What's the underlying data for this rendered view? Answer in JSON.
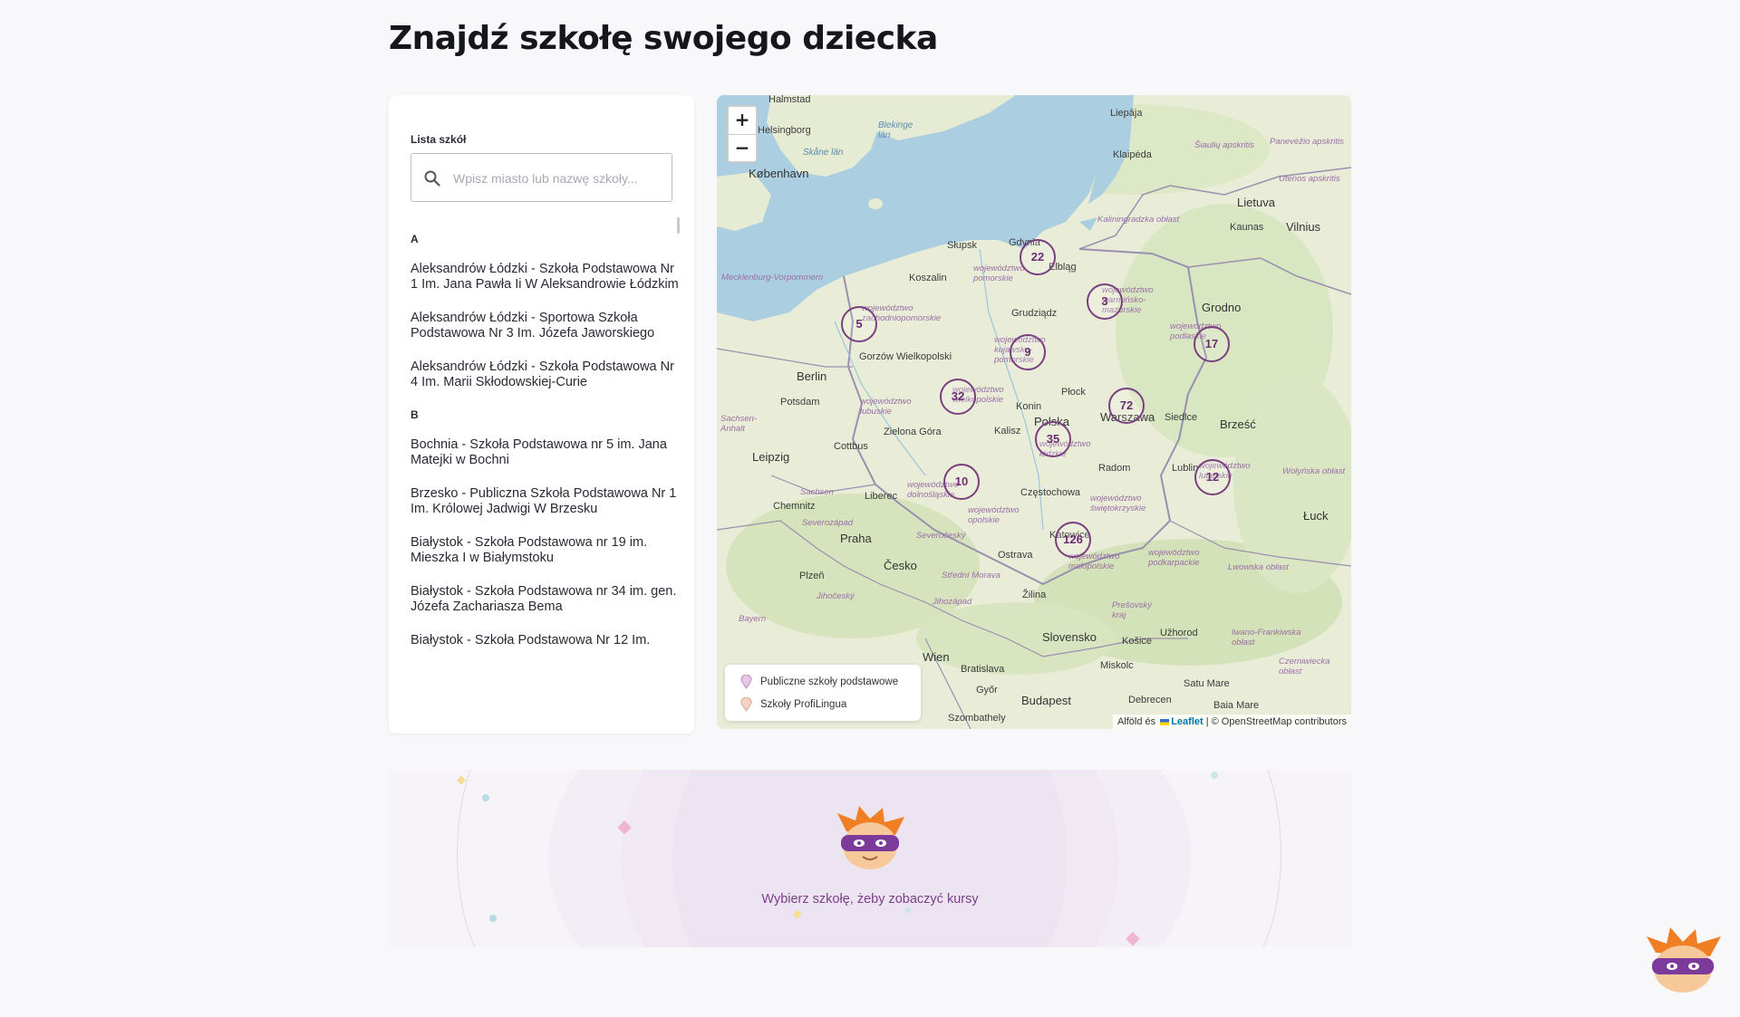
{
  "page": {
    "title": "Znajdź szkołę swojego dziecka"
  },
  "list": {
    "label": "Lista szkół",
    "search_placeholder": "Wpisz miasto lub nazwę szkoły...",
    "groups": [
      {
        "letter": "A",
        "items": [
          "Aleksandrów Łódzki - Szkoła Podstawowa Nr 1 Im. Jana Pawła Ii W Aleksandrowie Łódzkim",
          "Aleksandrów Łódzki - Sportowa Szkoła Podstawowa Nr 3 Im. Józefa Jaworskiego",
          "Aleksandrów Łódzki - Szkoła Podstawowa Nr 4 Im. Marii Skłodowskiej-Curie"
        ]
      },
      {
        "letter": "B",
        "items": [
          "Bochnia - Szkoła Podstawowa nr 5 im. Jana Matejki w Bochni",
          "Brzesko - Publiczna Szkoła Podstawowa Nr 1 Im. Królowej Jadwigi W Brzesku",
          "Białystok - Szkoła Podstawowa nr 19 im. Mieszka I w Białymstoku",
          "Białystok - Szkoła Podstawowa nr 34 im. gen. Józefa Zachariasza Bema",
          "Białystok - Szkoła Podstawowa Nr 12 Im."
        ]
      }
    ]
  },
  "map": {
    "zoom_in": "+",
    "zoom_out": "−",
    "clusters": [
      "22",
      "3",
      "5",
      "9",
      "17",
      "32",
      "72",
      "35",
      "10",
      "12",
      "126"
    ],
    "places": [
      "Halmstad",
      "Helsingborg",
      "København",
      "Liepāja",
      "Klaipėda",
      "Šiaulių apskritis",
      "Panevėžio apskritis",
      "Utenos apskritis",
      "Lietuva",
      "Kaunas",
      "Vilnius",
      "Słupsk",
      "Gdynia",
      "Elbląg",
      "Koszalin",
      "Kaliningradzka obłast",
      "Mecklenburg-Vorpommern",
      "Grudziądz",
      "Grodno",
      "Berlin",
      "Gorzów Wielkopolski",
      "Potsdam",
      "Płock",
      "Konin",
      "Polska",
      "Warszawa",
      "Siedlce",
      "Brześć",
      "Kalisz",
      "Zielona Góra",
      "Cottbus",
      "Leipzig",
      "Liberec",
      "Chemnitz",
      "Częstochowa",
      "Radom",
      "Lublin",
      "Łuck",
      "Praha",
      "Česko",
      "Ostrava",
      "Katowice",
      "Plzeň",
      "Žilina",
      "Slovensko",
      "Košice",
      "Užhorod",
      "Wien",
      "Bratislava",
      "Győr",
      "Budapest",
      "Miskolc",
      "Debrecen",
      "Satu Mare",
      "Baia Mare",
      "Szombathely"
    ],
    "regions": [
      "województwo pomorskie",
      "województwo warmińsko-mazurskie",
      "województwo zachodniopomorskie",
      "województwo kujawsko-pomorskie",
      "województwo podlaskie",
      "województwo lubuskie",
      "województwo wielkopolskie",
      "województwo łódzkie",
      "województwo mazowieckie",
      "województwo dolnośląskie",
      "województwo opolskie",
      "województwo świętokrzyskie",
      "województwo lubelskie",
      "województwo małopolskie",
      "województwo podkarpackie",
      "Sachsen-Anhalt",
      "Sachsen",
      "Bayern",
      "Jihočeský",
      "Severočeský",
      "Severozápad",
      "Střední Morava",
      "Jihozápad",
      "Prešovský kraj",
      "Wołyńska obłast",
      "Lwowska obłast",
      "Iwano-Frankiwska obłast",
      "Czerniwiecka obłast"
    ],
    "water": [
      "Blekinge län",
      "Skåne län"
    ],
    "legend": {
      "public": "Publiczne szkoły podstawowe",
      "profi": "Szkoły ProfiLingua",
      "public_color": "#e8c6e8",
      "profi_color": "#f6d2c4"
    },
    "attribution_prefix": "Alföld és",
    "attribution_leaflet": "Leaflet",
    "attribution_rest": "| © OpenStreetMap contributors"
  },
  "courses": {
    "prompt": "Wybierz szkołę, żeby zobaczyć kursy"
  },
  "colors": {
    "accent": "#7d3c8c",
    "cluster_border": "#7a3f7e",
    "sea": "#abcfe0",
    "land": "#e8ecd6"
  }
}
